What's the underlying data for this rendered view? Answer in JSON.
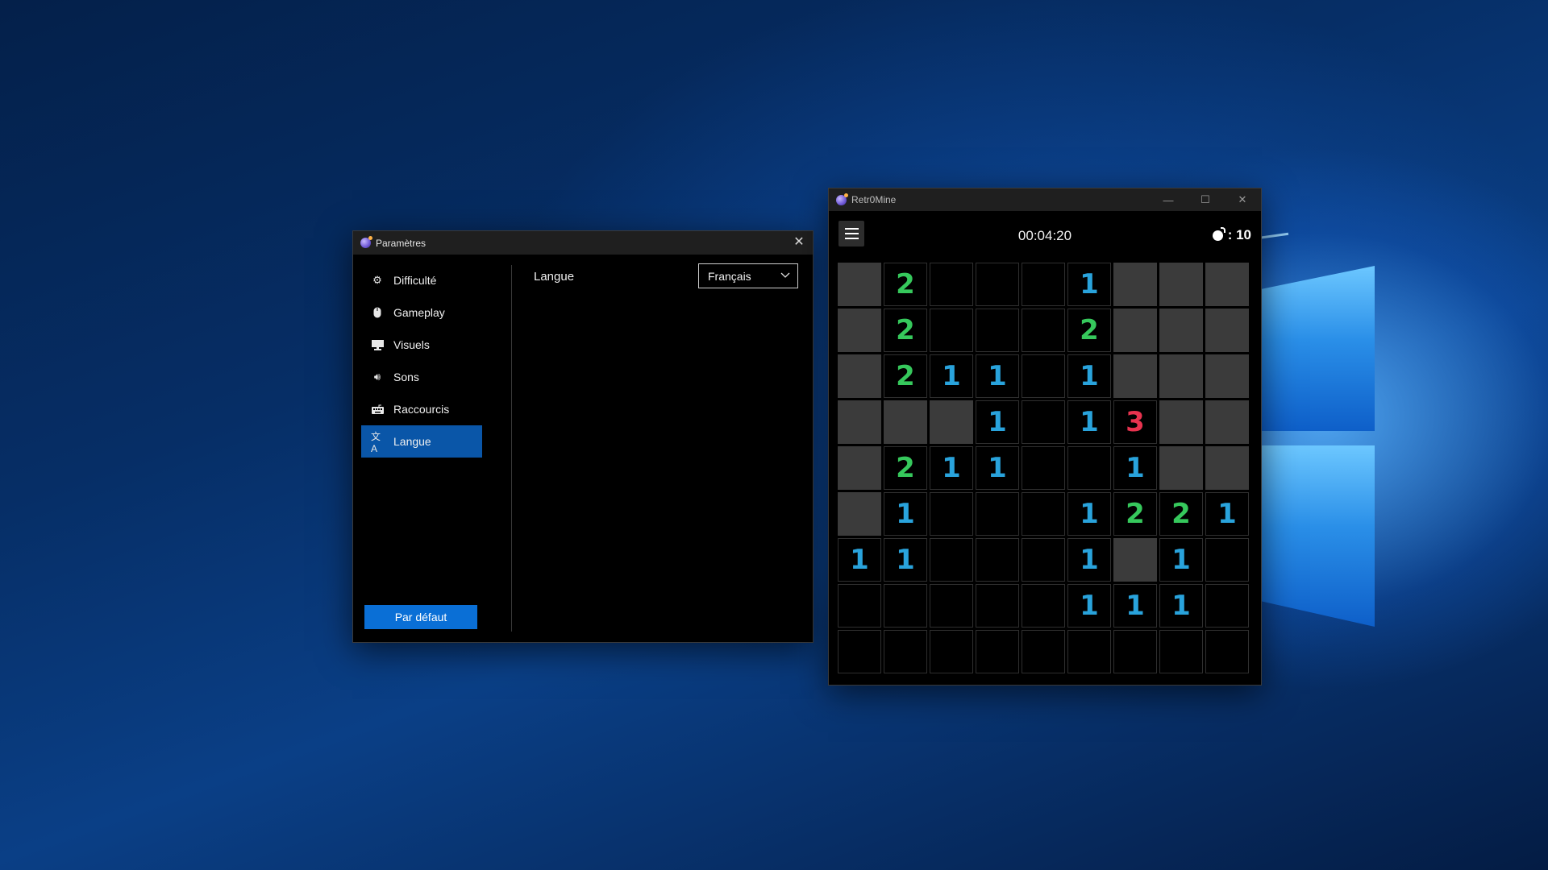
{
  "settings_window": {
    "title": "Paramètres",
    "nav": [
      {
        "label": "Difficulté",
        "icon": "gear-icon",
        "active": false
      },
      {
        "label": "Gameplay",
        "icon": "mouse-icon",
        "active": false
      },
      {
        "label": "Visuels",
        "icon": "monitor-icon",
        "active": false
      },
      {
        "label": "Sons",
        "icon": "speaker-icon",
        "active": false
      },
      {
        "label": "Raccourcis",
        "icon": "keyboard-icon",
        "active": false
      },
      {
        "label": "Langue",
        "icon": "translate-icon",
        "active": true
      }
    ],
    "default_button": "Par défaut",
    "language_label": "Langue",
    "language_value": "Français"
  },
  "game_window": {
    "title": "Retr0Mine",
    "timer": "00:04:20",
    "mine_count": ": 10",
    "board": [
      [
        "#",
        "2",
        "",
        "",
        "",
        "1",
        "#",
        "#",
        "#"
      ],
      [
        "#",
        "2",
        "",
        "",
        "",
        "2",
        "#",
        "#",
        "#"
      ],
      [
        "#",
        "2",
        "1",
        "1",
        "",
        "1",
        "#",
        "#",
        "#"
      ],
      [
        "#",
        "#",
        "#",
        "1",
        "",
        "1",
        "3",
        "#",
        "#"
      ],
      [
        "#",
        "2",
        "1",
        "1",
        "",
        "",
        "1",
        "#",
        "#"
      ],
      [
        "#",
        "1",
        "",
        "",
        "",
        "1",
        "2",
        "2",
        "1"
      ],
      [
        "1",
        "1",
        "",
        "",
        "",
        "1",
        "#",
        "1",
        ""
      ],
      [
        "",
        "",
        "",
        "",
        "",
        "1",
        "1",
        "1",
        ""
      ],
      [
        "",
        "",
        "",
        "",
        "",
        "",
        "",
        "",
        ""
      ]
    ]
  },
  "colors": {
    "accent": "#0a6fd6",
    "nav_active": "#0a56a8",
    "covered_cell": "#3b3b3b",
    "num1": "#29a3dc",
    "num2": "#36c85c",
    "num3": "#e8334f"
  }
}
